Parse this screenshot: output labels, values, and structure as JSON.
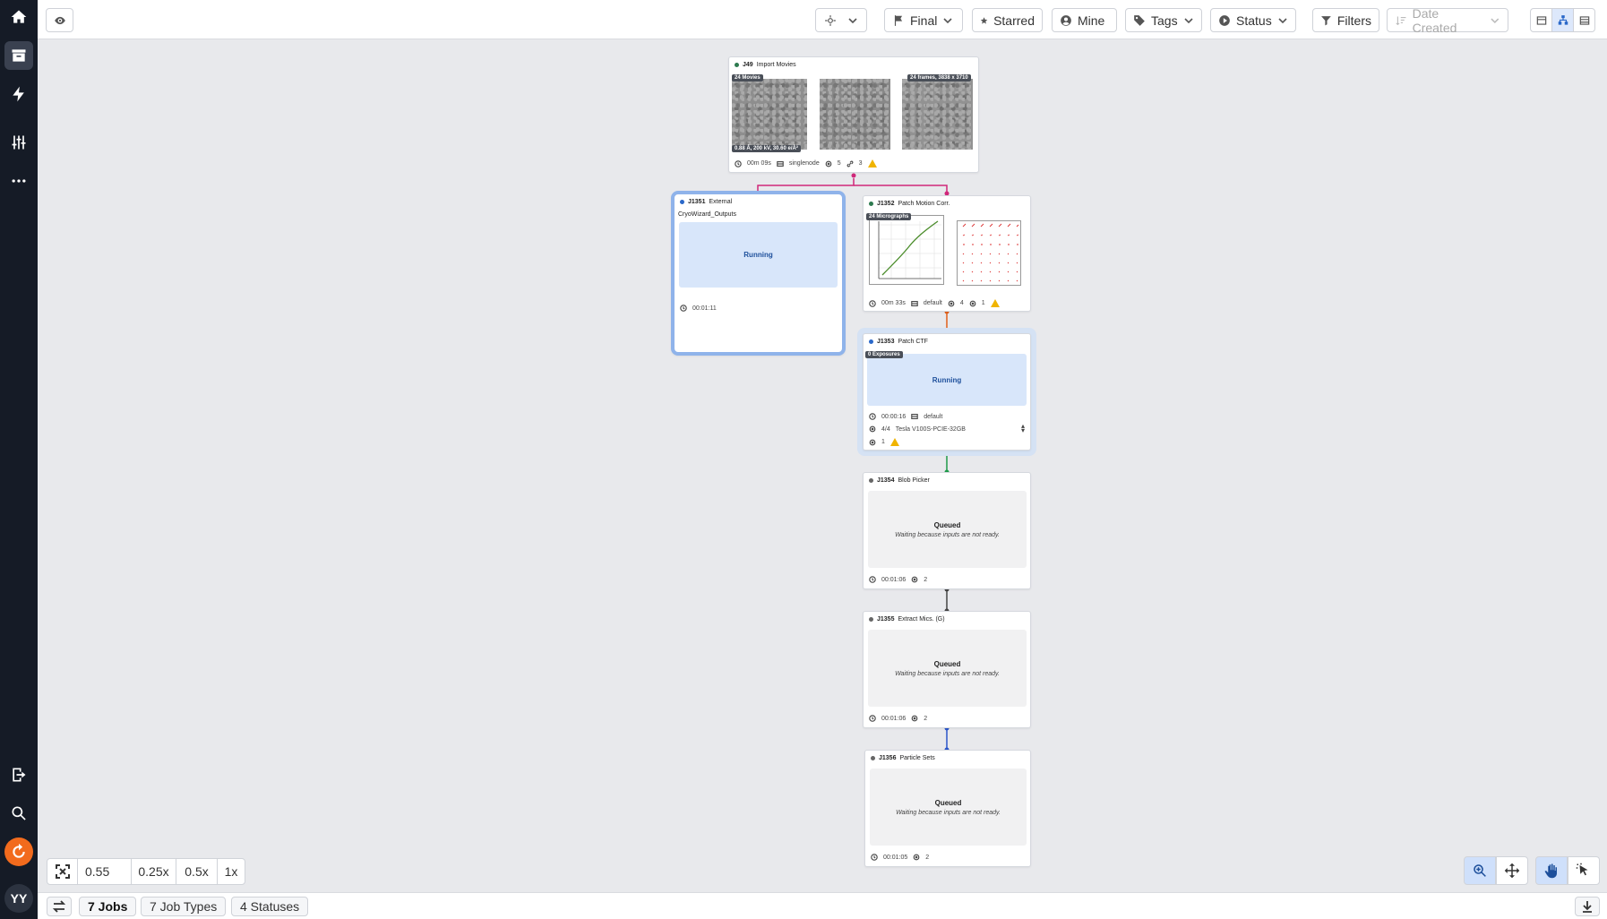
{
  "toolbar": {
    "final_label": "Final",
    "starred_label": "Starred",
    "mine_label": "Mine",
    "tags_label": "Tags",
    "status_label": "Status",
    "filters_label": "Filters",
    "sort_label": "Date Created"
  },
  "jobs": [
    {
      "id": "J49",
      "type": "Import Movies",
      "badge_left": "24 Movies",
      "badge_right": "24 frames, 3838 x 3710",
      "overlay": "0.88 Å, 200 kV, 30.60 e/Å²",
      "time": "00m 09s",
      "lane": "singlenode",
      "outputs": "5",
      "links": "3"
    },
    {
      "id": "J1351",
      "type": "External",
      "subtitle": "CryoWizard_Outputs",
      "status": "Running",
      "time": "00:01:11"
    },
    {
      "id": "J1352",
      "type": "Patch Motion Corr.",
      "badge_left": "24 Micrographs",
      "time": "00m 33s",
      "lane": "default",
      "outputs": "4",
      "params": "1"
    },
    {
      "id": "J1353",
      "type": "Patch CTF",
      "badge_left": "0 Exposures",
      "status": "Running",
      "time": "00:00:16",
      "lane": "default",
      "gpu_count": "4/4",
      "gpu_name": "Tesla V100S-PCIE-32GB",
      "params": "1"
    },
    {
      "id": "J1354",
      "type": "Blob Picker",
      "status": "Queued",
      "status_detail": "Waiting because inputs are not ready.",
      "time": "00:01:06",
      "params": "2"
    },
    {
      "id": "J1355",
      "type": "Extract Mics. (G)",
      "status": "Queued",
      "status_detail": "Waiting because inputs are not ready.",
      "time": "00:01:06",
      "params": "2"
    },
    {
      "id": "J1356",
      "type": "Particle Sets",
      "status": "Queued",
      "status_detail": "Waiting because inputs are not ready.",
      "time": "00:01:05",
      "params": "2"
    }
  ],
  "zoom": {
    "value": "0.55",
    "presets": [
      "0.25x",
      "0.5x",
      "1x"
    ]
  },
  "statusbar": {
    "jobs": "7 Jobs",
    "job_types": "7 Job Types",
    "statuses": "4 Statuses"
  },
  "sidebar": {
    "avatar": "YY"
  },
  "colors": {
    "edge_pink": "#d0287a",
    "edge_orange": "#e0601a",
    "edge_green": "#1f9a4a",
    "edge_gray": "#444444",
    "edge_blue": "#2a55c9",
    "running_bg": "#d8e6fa",
    "accent_orange": "#f26b1d"
  }
}
